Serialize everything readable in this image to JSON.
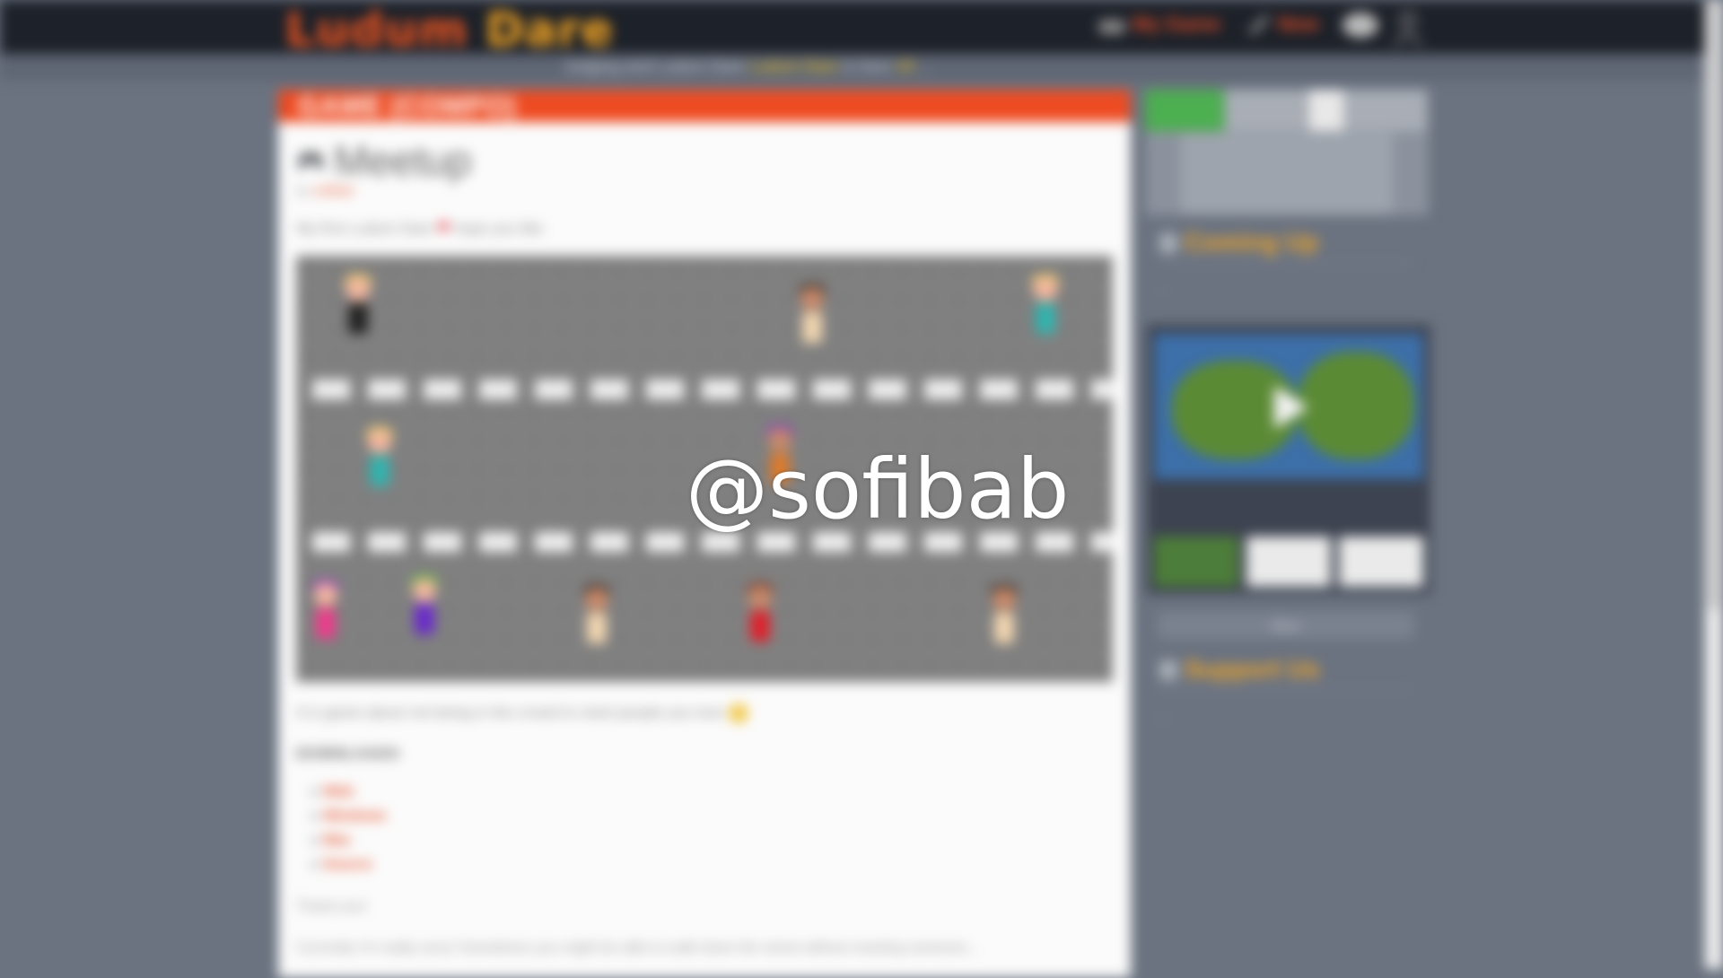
{
  "site": {
    "logo_part1": "Ludum",
    "logo_part2": "Dare"
  },
  "nav": {
    "my_game_label": "My Game",
    "new_label": "New",
    "icons": [
      "gamepad-icon",
      "pencil-icon",
      "chat-icon",
      "user-icon"
    ]
  },
  "subbar": {
    "text_start": "Judging and Ludum Dare",
    "highlight1": "Ludum Dare",
    "text_mid": "is here",
    "highlight2": "4X",
    "text_end": "..."
  },
  "game": {
    "banner": "GAME (COMPO)",
    "title": "Meetup",
    "byline_prefix": "by",
    "author": "sofibab",
    "tagline_start": "My first Ludum Dare",
    "tagline_end": "hope you like",
    "description": "It is game about not being in the crowd to meet people you love",
    "downloads_header": "DOWNLOADS",
    "downloads": [
      "Web",
      "Windows",
      "Mac",
      "Source"
    ],
    "thanks": "Thank you!",
    "paragraph": "Currently I'm really sorry! Sometimes you might be able to walk down the street without meeting someone..."
  },
  "sidebar": {
    "coming_up_title": "Coming Up",
    "coming_up_lines": [
      "..."
    ],
    "more_button": "More",
    "support_title": "Support Us",
    "support_lines": [
      "..."
    ]
  },
  "watermark": "@sofibab",
  "colors": {
    "brand_orange": "#ee4b22",
    "accent_gold": "#f5a623",
    "bg": "#6b7380"
  }
}
